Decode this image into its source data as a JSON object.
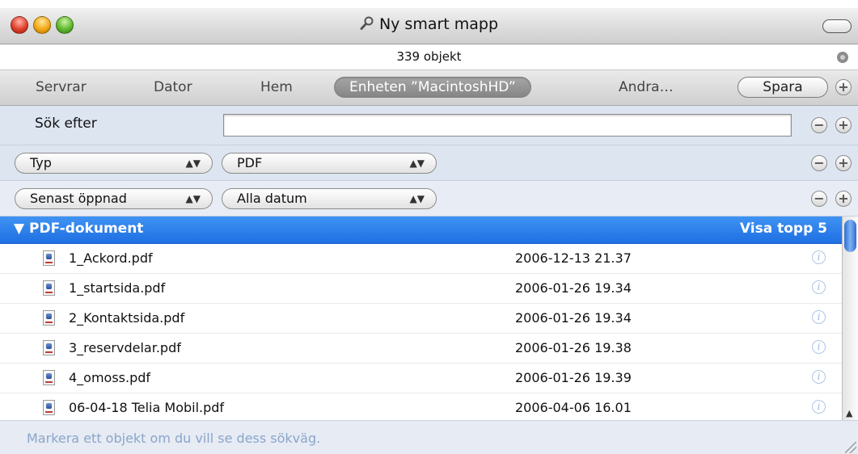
{
  "window": {
    "title": "Ny smart mapp"
  },
  "status": {
    "count": "339 objekt"
  },
  "scope": {
    "items": [
      "Servrar",
      "Dator",
      "Hem",
      "Enheten ”MacintoshHD”",
      "Andra…"
    ],
    "selected_index": 3,
    "save_label": "Spara"
  },
  "criteria": {
    "search_label": "Sök efter",
    "search_value": "",
    "rows": [
      {
        "attribute": "Typ",
        "value": "PDF"
      },
      {
        "attribute": "Senast öppnad",
        "value": "Alla datum"
      }
    ],
    "remove_glyph": "−",
    "add_glyph": "+"
  },
  "results": {
    "group_title": "▼ PDF-dokument",
    "show_top_label": "Visa topp 5",
    "info_glyph": "i",
    "rows": [
      {
        "name": "1_Ackord.pdf",
        "date": "2006-12-13 21.37"
      },
      {
        "name": "1_startsida.pdf",
        "date": "2006-01-26 19.34"
      },
      {
        "name": "2_Kontaktsida.pdf",
        "date": "2006-01-26 19.34"
      },
      {
        "name": "3_reservdelar.pdf",
        "date": "2006-01-26 19.38"
      },
      {
        "name": "4_omoss.pdf",
        "date": "2006-01-26 19.39"
      },
      {
        "name": "06-04-18 Telia Mobil.pdf",
        "date": "2006-04-06 16.01"
      }
    ]
  },
  "scrollbar": {
    "up_glyph": "▲",
    "down_glyph": "▼"
  },
  "footer": {
    "path_hint": "Markera ett objekt om du vill se dess sökväg."
  },
  "colors": {
    "selection_header": "#2f80ee",
    "criteria_bg": "#dde5f1",
    "footer_text": "#8ba5c9"
  }
}
